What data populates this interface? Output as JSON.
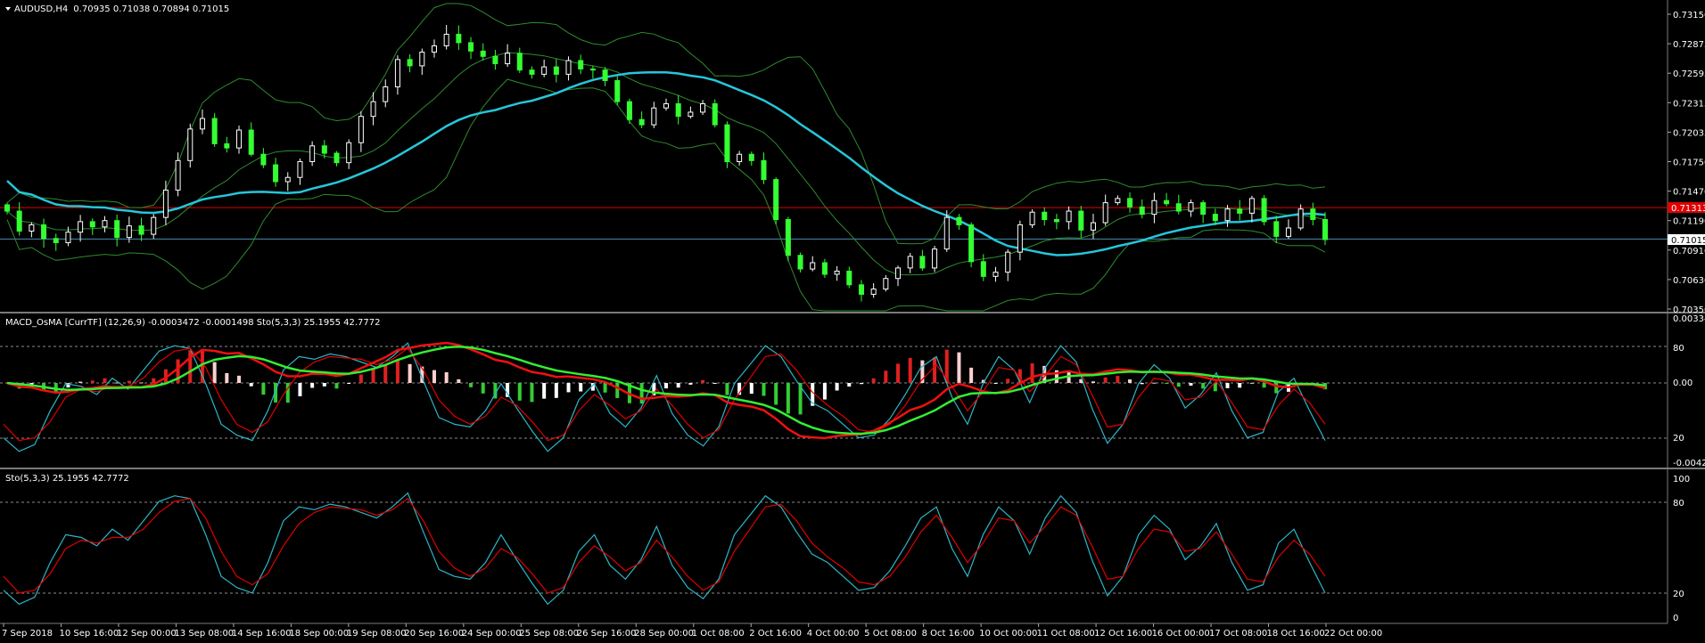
{
  "symbol_header": {
    "symbol": "AUDUSD,H4",
    "ohlc": "0.70935 0.71038 0.70894 0.71015"
  },
  "indicator1_header": "MACD_OsMA [CurrTF] (12,26,9) -0.0003472 -0.0001498  Sto(5,3,3) 25.1955 42.7772",
  "indicator2_header": "Sto(5,3,3) 25.1955 42.7772",
  "price_axis_labels": [
    "0.73150",
    "0.72875",
    "0.72595",
    "0.72315",
    "0.72035",
    "0.71750",
    "0.71470",
    "0.71190",
    "0.70910",
    "0.70630",
    "0.70350"
  ],
  "price_tags": {
    "red_line": "0.71313",
    "current": "0.71015"
  },
  "macd_axis_labels": [
    "0.003342",
    "80",
    "0.00",
    "20",
    "-0.004296"
  ],
  "stoch_axis_labels": [
    "100",
    "80",
    "20",
    "0"
  ],
  "time_axis_labels": [
    "7 Sep 2018",
    "10 Sep 16:00",
    "12 Sep 00:00",
    "13 Sep 08:00",
    "14 Sep 16:00",
    "18 Sep 00:00",
    "19 Sep 08:00",
    "20 Sep 16:00",
    "24 Sep 00:00",
    "25 Sep 08:00",
    "26 Sep 16:00",
    "28 Sep 00:00",
    "1 Oct 08:00",
    "2 Oct 16:00",
    "4 Oct 00:00",
    "5 Oct 08:00",
    "8 Oct 16:00",
    "10 Oct 00:00",
    "11 Oct 08:00",
    "12 Oct 16:00",
    "16 Oct 00:00",
    "17 Oct 08:00",
    "18 Oct 16:00",
    "22 Oct 00:00"
  ],
  "colors": {
    "background": "#000000",
    "bull_candle": "#ffffff",
    "bear_candle": "#33ff33",
    "bollinger": "#2e8b2e",
    "ma": "#26c6da",
    "hline_red": "#e00000",
    "hline_current": "#4a8fb0",
    "hist_pos": "#e02020",
    "hist_neg": "#33cc33",
    "hist_light": "#ffd0d0",
    "sto_main": "#2bb7c8",
    "sto_signal": "#e00000",
    "macd_green": "#33ee33"
  },
  "chart_data": {
    "type": "candlestick",
    "title": "AUDUSD,H4",
    "y_range": [
      0.7035,
      0.7315
    ],
    "close_path": [
      0.7128,
      0.7109,
      0.7115,
      0.7102,
      0.7098,
      0.7108,
      0.7118,
      0.7113,
      0.7119,
      0.7103,
      0.7114,
      0.7106,
      0.7122,
      0.7148,
      0.7176,
      0.7206,
      0.7216,
      0.7192,
      0.7188,
      0.7205,
      0.7182,
      0.7172,
      0.7156,
      0.716,
      0.7175,
      0.719,
      0.7183,
      0.7174,
      0.7193,
      0.7218,
      0.7232,
      0.7246,
      0.7272,
      0.7266,
      0.7279,
      0.7285,
      0.7296,
      0.7288,
      0.728,
      0.7275,
      0.7268,
      0.7278,
      0.7262,
      0.7258,
      0.7265,
      0.7258,
      0.7271,
      0.7263,
      0.7262,
      0.7252,
      0.7232,
      0.7215,
      0.721,
      0.7226,
      0.723,
      0.7218,
      0.7222,
      0.723,
      0.721,
      0.7175,
      0.7182,
      0.7176,
      0.7158,
      0.712,
      0.7086,
      0.7073,
      0.7079,
      0.7068,
      0.7071,
      0.7058,
      0.7049,
      0.7054,
      0.7064,
      0.7074,
      0.7085,
      0.7074,
      0.7092,
      0.7122,
      0.7115,
      0.708,
      0.7066,
      0.707,
      0.7089,
      0.7115,
      0.7127,
      0.712,
      0.7118,
      0.7128,
      0.711,
      0.7117,
      0.7136,
      0.714,
      0.7132,
      0.7125,
      0.7138,
      0.7135,
      0.7128,
      0.7136,
      0.7125,
      0.7119,
      0.713,
      0.7126,
      0.714,
      0.7118,
      0.7104,
      0.7112,
      0.713,
      0.712,
      0.7101
    ],
    "sto_main": [
      20,
      10,
      15,
      40,
      60,
      58,
      52,
      64,
      56,
      70,
      84,
      88,
      86,
      60,
      30,
      22,
      18,
      40,
      70,
      80,
      78,
      82,
      80,
      76,
      72,
      80,
      90,
      62,
      35,
      30,
      28,
      40,
      60,
      42,
      25,
      10,
      20,
      48,
      60,
      38,
      28,
      42,
      66,
      38,
      22,
      14,
      28,
      60,
      74,
      88,
      80,
      62,
      46,
      40,
      30,
      20,
      22,
      34,
      52,
      72,
      80,
      50,
      30,
      60,
      80,
      70,
      46,
      72,
      88,
      76,
      42,
      16,
      30,
      60,
      74,
      64,
      42,
      52,
      68,
      40,
      20,
      24,
      54,
      64,
      40,
      18
    ],
    "sto_signal": [
      30,
      18,
      20,
      32,
      50,
      56,
      54,
      58,
      58,
      64,
      76,
      84,
      86,
      72,
      48,
      30,
      24,
      32,
      52,
      68,
      76,
      80,
      79,
      78,
      74,
      78,
      86,
      70,
      48,
      36,
      30,
      36,
      50,
      44,
      32,
      18,
      22,
      40,
      52,
      44,
      34,
      40,
      56,
      44,
      30,
      20,
      26,
      48,
      64,
      80,
      82,
      70,
      54,
      44,
      36,
      26,
      24,
      30,
      44,
      62,
      74,
      58,
      40,
      54,
      72,
      70,
      54,
      66,
      80,
      74,
      52,
      28,
      30,
      50,
      64,
      62,
      48,
      50,
      62,
      46,
      28,
      26,
      44,
      56,
      46,
      30
    ]
  }
}
